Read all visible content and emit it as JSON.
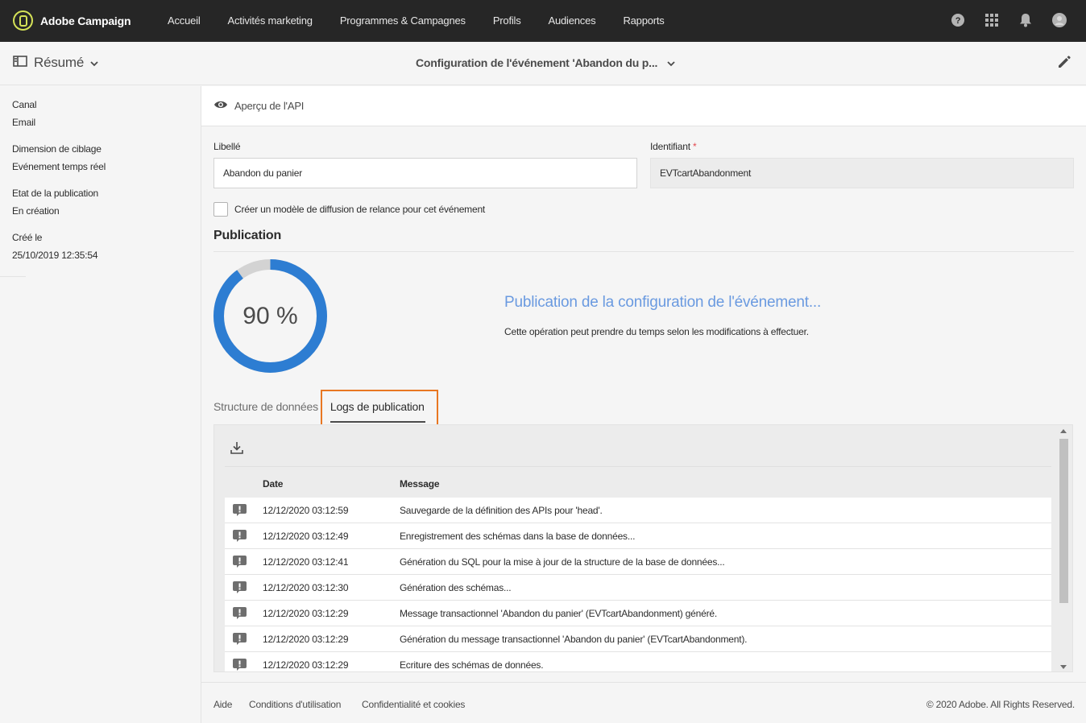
{
  "app": {
    "name": "Adobe Campaign"
  },
  "nav": {
    "items": [
      {
        "label": "Accueil"
      },
      {
        "label": "Activités marketing"
      },
      {
        "label": "Programmes & Campagnes"
      },
      {
        "label": "Profils"
      },
      {
        "label": "Audiences"
      },
      {
        "label": "Rapports"
      }
    ],
    "icons": [
      "help-icon",
      "apps-grid-icon",
      "notifications-bell-icon",
      "user-avatar-icon"
    ]
  },
  "subheader": {
    "resume_label": "Résumé",
    "title": "Configuration de l'événement 'Abandon du p..."
  },
  "sidebar": {
    "fields": [
      {
        "label": "Canal",
        "value": "Email"
      },
      {
        "label": "Dimension de ciblage",
        "value": "Evénement temps réel"
      },
      {
        "label": "Etat de la publication",
        "value": "En création"
      },
      {
        "label": "Créé le",
        "value": "25/10/2019 12:35:54"
      }
    ]
  },
  "main": {
    "api_preview_label": "Aperçu de l'API",
    "libelle_label": "Libellé",
    "libelle_value": "Abandon du panier",
    "identifiant_label": "Identifiant",
    "identifiant_required": "*",
    "identifiant_value": "EVTcartAbandonment",
    "checkbox_label": "Créer un modèle de diffusion de relance pour cet événement",
    "checkbox_checked": false,
    "publication_title": "Publication",
    "progress_percent": 90,
    "progress_text": "90 %",
    "status_title": "Publication de la configuration de l'événement...",
    "status_desc": "Cette opération peut prendre du temps selon les modifications à effectuer.",
    "tabs": [
      {
        "label": "Structure de données",
        "active": false
      },
      {
        "label": "Logs de publication",
        "active": true
      }
    ]
  },
  "logs": {
    "columns": {
      "date": "Date",
      "message": "Message"
    },
    "rows": [
      {
        "date": "12/12/2020 03:12:59",
        "message": "Sauvegarde de la définition des APIs pour 'head'."
      },
      {
        "date": "12/12/2020 03:12:49",
        "message": "Enregistrement des schémas dans la base de données..."
      },
      {
        "date": "12/12/2020 03:12:41",
        "message": "Génération du SQL pour la mise à jour de la structure de la base de données..."
      },
      {
        "date": "12/12/2020 03:12:30",
        "message": "Génération des schémas..."
      },
      {
        "date": "12/12/2020 03:12:29",
        "message": "Message transactionnel 'Abandon du panier' (EVTcartAbandonment) généré."
      },
      {
        "date": "12/12/2020 03:12:29",
        "message": "Génération du message transactionnel 'Abandon du panier' (EVTcartAbandonment)."
      },
      {
        "date": "12/12/2020 03:12:29",
        "message": "Ecriture des schémas de données."
      }
    ]
  },
  "footer": {
    "links": [
      {
        "label": "Aide"
      },
      {
        "label": "Conditions d'utilisation"
      },
      {
        "label": "Confidentialité et cookies"
      }
    ],
    "copyright": "© 2020 Adobe. All Rights Reserved."
  },
  "colors": {
    "topbar": "#262626",
    "progress": "#2d7dd2",
    "progress_remaining": "#d3d3d3",
    "status_text": "#6a9ae0",
    "highlight": "#e87722"
  }
}
